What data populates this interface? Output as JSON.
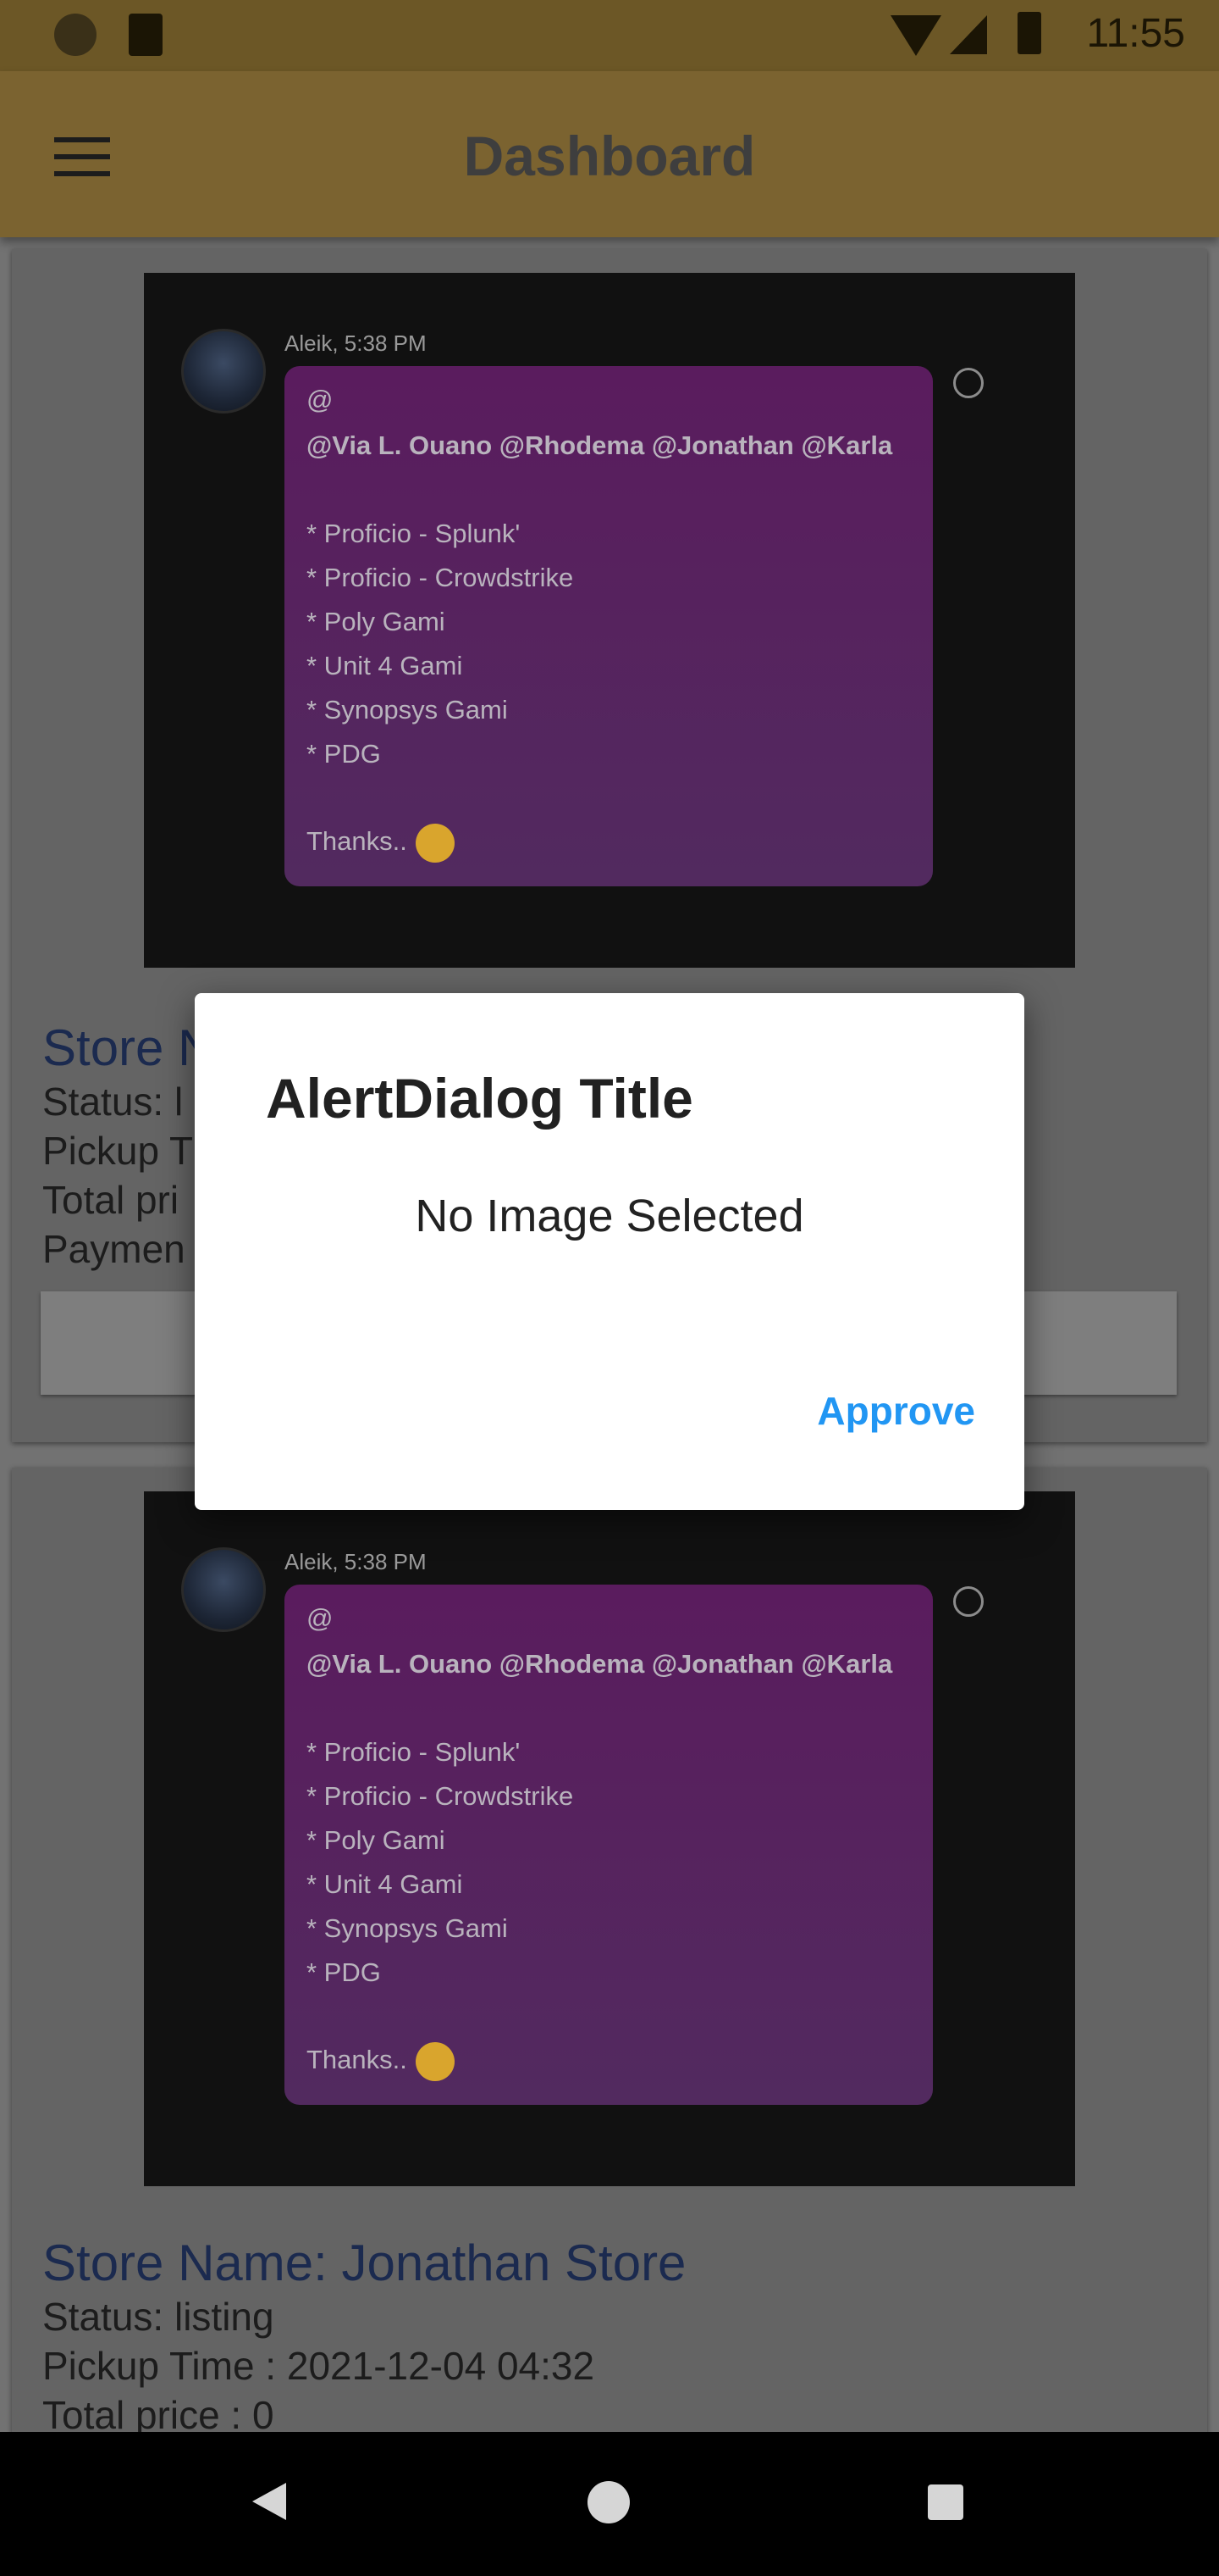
{
  "status_bar": {
    "time": "11:55"
  },
  "app_bar": {
    "title": "Dashboard"
  },
  "cards": [
    {
      "screenshot": {
        "meta": "Aleik, 5:38 PM",
        "at": "@",
        "mentions": "@Via L. Ouano @Rhodema @Jonathan @Karla",
        "items": [
          "* Proficio - Splunk'",
          "* Proficio - Crowdstrike",
          "* Poly Gami",
          "* Unit 4 Gami",
          "* Synopsys Gami",
          "* PDG"
        ],
        "thanks": "Thanks.."
      },
      "store_name": "Store N",
      "status": "Status: l",
      "pickup": "Pickup T",
      "total": "Total pri",
      "payment": "Paymen"
    },
    {
      "screenshot": {
        "meta": "Aleik, 5:38 PM",
        "at": "@",
        "mentions": "@Via L. Ouano @Rhodema @Jonathan @Karla",
        "items": [
          "* Proficio - Splunk'",
          "* Proficio - Crowdstrike",
          "* Poly Gami",
          "* Unit 4 Gami",
          "* Synopsys Gami",
          "* PDG"
        ],
        "thanks": "Thanks.."
      },
      "store_name": "Store Name: Jonathan Store",
      "status": "Status: listing",
      "pickup": "Pickup Time : 2021-12-04 04:32",
      "total": "Total price : 0"
    }
  ],
  "dialog": {
    "title": "AlertDialog Title",
    "message": "No Image Selected",
    "button": "Approve",
    "button_color": "#2196f3"
  },
  "colors": {
    "scrim": "#727272",
    "app_bar": "#7b6330"
  }
}
